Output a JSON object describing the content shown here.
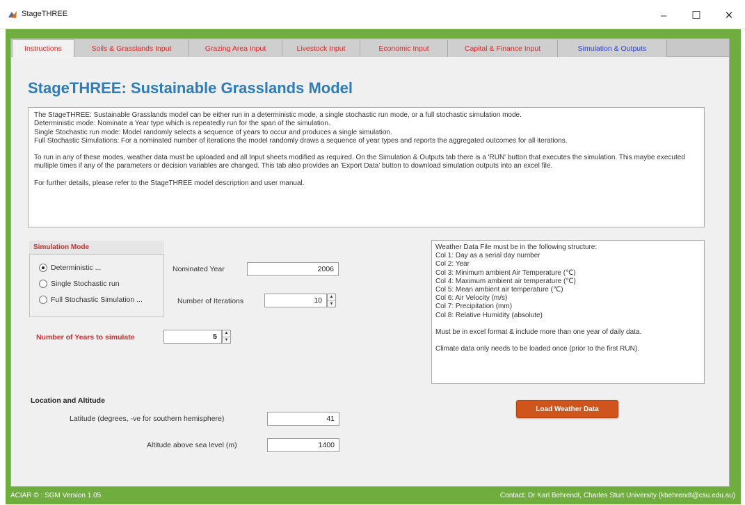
{
  "window": {
    "title": "StageTHREE",
    "minimize": "–",
    "maximize": "☐",
    "close": "✕"
  },
  "tabs": [
    {
      "label": "Instructions"
    },
    {
      "label": "Soils & Grasslands Input"
    },
    {
      "label": "Grazing Area Input"
    },
    {
      "label": "Livestock Input"
    },
    {
      "label": "Economic Input"
    },
    {
      "label": "Capital & Finance Input"
    },
    {
      "label": "Simulation & Outputs"
    }
  ],
  "active_tab": "Instructions",
  "heading": "StageTHREE: Sustainable Grasslands Model",
  "intro": {
    "lines": [
      "The StageTHREE: Sustainable Grasslands model can be either run in a deterministic mode, a single stochastic run mode, or a full stochastic simulation mode.",
      "Deterministic mode: Nominate a Year type which is repeatedly run for the span of the simulation.",
      "Single Stochastic run mode: Model randomly selects a sequence of years to occur and produces a single simulation.",
      "Full Stochastic Simulations: For a nominated number of iterations the model randomly draws a sequence of year types and reports the aggregated outcomes for all iterations.",
      "To run in any of these modes, weather data must be uploaded and all Input sheets modified as required. On the Simulation & Outputs tab there is a 'RUN' button that executes the simulation. This maybe executed multiple times if any of the parameters or decision variables are changed. This tab also provides an 'Export Data' button to download simulation outputs into an excel file.",
      "For further details, please refer to the StageTHREE model description and user manual."
    ]
  },
  "simulation_mode": {
    "title": "Simulation Mode",
    "options": [
      {
        "label": "Deterministic ...",
        "selected": true
      },
      {
        "label": "Single Stochastic run",
        "selected": false
      },
      {
        "label": "Full Stochastic Simulation ...",
        "selected": false
      }
    ]
  },
  "nominated_year": {
    "label": "Nominated Year",
    "value": "2006"
  },
  "iterations": {
    "label": "Number of Iterations",
    "value": "10"
  },
  "years_to_simulate": {
    "label": "Number of Years to simulate",
    "value": "5"
  },
  "weather_info": {
    "lines": [
      "Weather Data File must be in the following structure:",
      "Col 1: Day as a serial day number",
      "Col 2: Year",
      "Col 3: Minimum ambient Air Temperature (℃)",
      "Col 4: Maximum ambient air temperature (℃)",
      "Col 5: Mean ambient air temperature (℃)",
      "Col 6: Air Velocity (m/s)",
      "Col 7: Precipitation (mm)",
      "Col 8: Relative Humidity (absolute)",
      "Must be in excel format & include more than one year of daily data.",
      "Climate data only needs to be loaded once (prior to the first RUN)."
    ]
  },
  "load_weather_button": "Load Weather Data",
  "location": {
    "title": "Location and Altitude",
    "latitude_label": "Latitude (degrees, -ve for southern hemisphere)",
    "latitude_value": "41",
    "altitude_label": "Altitude above sea level (m)",
    "altitude_value": "1400"
  },
  "footer": {
    "left": "ACIAR © : SGM Version 1.05",
    "right": "Contact: Dr Karl Behrendt, Charles Sturt University (kbehrendt@csu.edu.au)"
  },
  "colors": {
    "frame_green": "#6fae3e",
    "heading_blue": "#2c7db9",
    "tab_red": "#d42b2b",
    "tab_blue": "#2c3fd6",
    "button_orange": "#d0551c"
  }
}
